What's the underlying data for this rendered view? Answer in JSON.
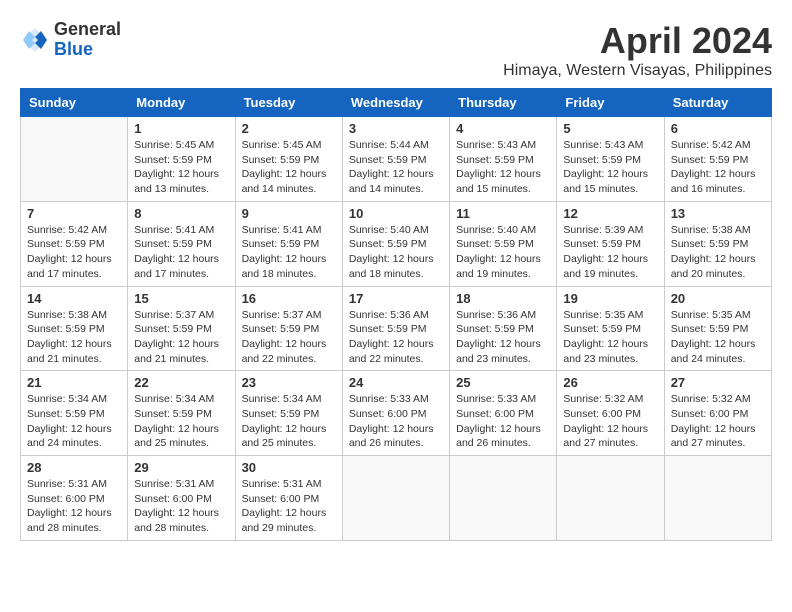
{
  "header": {
    "logo_general": "General",
    "logo_blue": "Blue",
    "month_title": "April 2024",
    "location": "Himaya, Western Visayas, Philippines"
  },
  "days_of_week": [
    "Sunday",
    "Monday",
    "Tuesday",
    "Wednesday",
    "Thursday",
    "Friday",
    "Saturday"
  ],
  "weeks": [
    [
      {
        "day": "",
        "sunrise": "",
        "sunset": "",
        "daylight": ""
      },
      {
        "day": "1",
        "sunrise": "Sunrise: 5:45 AM",
        "sunset": "Sunset: 5:59 PM",
        "daylight": "Daylight: 12 hours and 13 minutes."
      },
      {
        "day": "2",
        "sunrise": "Sunrise: 5:45 AM",
        "sunset": "Sunset: 5:59 PM",
        "daylight": "Daylight: 12 hours and 14 minutes."
      },
      {
        "day": "3",
        "sunrise": "Sunrise: 5:44 AM",
        "sunset": "Sunset: 5:59 PM",
        "daylight": "Daylight: 12 hours and 14 minutes."
      },
      {
        "day": "4",
        "sunrise": "Sunrise: 5:43 AM",
        "sunset": "Sunset: 5:59 PM",
        "daylight": "Daylight: 12 hours and 15 minutes."
      },
      {
        "day": "5",
        "sunrise": "Sunrise: 5:43 AM",
        "sunset": "Sunset: 5:59 PM",
        "daylight": "Daylight: 12 hours and 15 minutes."
      },
      {
        "day": "6",
        "sunrise": "Sunrise: 5:42 AM",
        "sunset": "Sunset: 5:59 PM",
        "daylight": "Daylight: 12 hours and 16 minutes."
      }
    ],
    [
      {
        "day": "7",
        "sunrise": "Sunrise: 5:42 AM",
        "sunset": "Sunset: 5:59 PM",
        "daylight": "Daylight: 12 hours and 17 minutes."
      },
      {
        "day": "8",
        "sunrise": "Sunrise: 5:41 AM",
        "sunset": "Sunset: 5:59 PM",
        "daylight": "Daylight: 12 hours and 17 minutes."
      },
      {
        "day": "9",
        "sunrise": "Sunrise: 5:41 AM",
        "sunset": "Sunset: 5:59 PM",
        "daylight": "Daylight: 12 hours and 18 minutes."
      },
      {
        "day": "10",
        "sunrise": "Sunrise: 5:40 AM",
        "sunset": "Sunset: 5:59 PM",
        "daylight": "Daylight: 12 hours and 18 minutes."
      },
      {
        "day": "11",
        "sunrise": "Sunrise: 5:40 AM",
        "sunset": "Sunset: 5:59 PM",
        "daylight": "Daylight: 12 hours and 19 minutes."
      },
      {
        "day": "12",
        "sunrise": "Sunrise: 5:39 AM",
        "sunset": "Sunset: 5:59 PM",
        "daylight": "Daylight: 12 hours and 19 minutes."
      },
      {
        "day": "13",
        "sunrise": "Sunrise: 5:38 AM",
        "sunset": "Sunset: 5:59 PM",
        "daylight": "Daylight: 12 hours and 20 minutes."
      }
    ],
    [
      {
        "day": "14",
        "sunrise": "Sunrise: 5:38 AM",
        "sunset": "Sunset: 5:59 PM",
        "daylight": "Daylight: 12 hours and 21 minutes."
      },
      {
        "day": "15",
        "sunrise": "Sunrise: 5:37 AM",
        "sunset": "Sunset: 5:59 PM",
        "daylight": "Daylight: 12 hours and 21 minutes."
      },
      {
        "day": "16",
        "sunrise": "Sunrise: 5:37 AM",
        "sunset": "Sunset: 5:59 PM",
        "daylight": "Daylight: 12 hours and 22 minutes."
      },
      {
        "day": "17",
        "sunrise": "Sunrise: 5:36 AM",
        "sunset": "Sunset: 5:59 PM",
        "daylight": "Daylight: 12 hours and 22 minutes."
      },
      {
        "day": "18",
        "sunrise": "Sunrise: 5:36 AM",
        "sunset": "Sunset: 5:59 PM",
        "daylight": "Daylight: 12 hours and 23 minutes."
      },
      {
        "day": "19",
        "sunrise": "Sunrise: 5:35 AM",
        "sunset": "Sunset: 5:59 PM",
        "daylight": "Daylight: 12 hours and 23 minutes."
      },
      {
        "day": "20",
        "sunrise": "Sunrise: 5:35 AM",
        "sunset": "Sunset: 5:59 PM",
        "daylight": "Daylight: 12 hours and 24 minutes."
      }
    ],
    [
      {
        "day": "21",
        "sunrise": "Sunrise: 5:34 AM",
        "sunset": "Sunset: 5:59 PM",
        "daylight": "Daylight: 12 hours and 24 minutes."
      },
      {
        "day": "22",
        "sunrise": "Sunrise: 5:34 AM",
        "sunset": "Sunset: 5:59 PM",
        "daylight": "Daylight: 12 hours and 25 minutes."
      },
      {
        "day": "23",
        "sunrise": "Sunrise: 5:34 AM",
        "sunset": "Sunset: 5:59 PM",
        "daylight": "Daylight: 12 hours and 25 minutes."
      },
      {
        "day": "24",
        "sunrise": "Sunrise: 5:33 AM",
        "sunset": "Sunset: 6:00 PM",
        "daylight": "Daylight: 12 hours and 26 minutes."
      },
      {
        "day": "25",
        "sunrise": "Sunrise: 5:33 AM",
        "sunset": "Sunset: 6:00 PM",
        "daylight": "Daylight: 12 hours and 26 minutes."
      },
      {
        "day": "26",
        "sunrise": "Sunrise: 5:32 AM",
        "sunset": "Sunset: 6:00 PM",
        "daylight": "Daylight: 12 hours and 27 minutes."
      },
      {
        "day": "27",
        "sunrise": "Sunrise: 5:32 AM",
        "sunset": "Sunset: 6:00 PM",
        "daylight": "Daylight: 12 hours and 27 minutes."
      }
    ],
    [
      {
        "day": "28",
        "sunrise": "Sunrise: 5:31 AM",
        "sunset": "Sunset: 6:00 PM",
        "daylight": "Daylight: 12 hours and 28 minutes."
      },
      {
        "day": "29",
        "sunrise": "Sunrise: 5:31 AM",
        "sunset": "Sunset: 6:00 PM",
        "daylight": "Daylight: 12 hours and 28 minutes."
      },
      {
        "day": "30",
        "sunrise": "Sunrise: 5:31 AM",
        "sunset": "Sunset: 6:00 PM",
        "daylight": "Daylight: 12 hours and 29 minutes."
      },
      {
        "day": "",
        "sunrise": "",
        "sunset": "",
        "daylight": ""
      },
      {
        "day": "",
        "sunrise": "",
        "sunset": "",
        "daylight": ""
      },
      {
        "day": "",
        "sunrise": "",
        "sunset": "",
        "daylight": ""
      },
      {
        "day": "",
        "sunrise": "",
        "sunset": "",
        "daylight": ""
      }
    ]
  ]
}
